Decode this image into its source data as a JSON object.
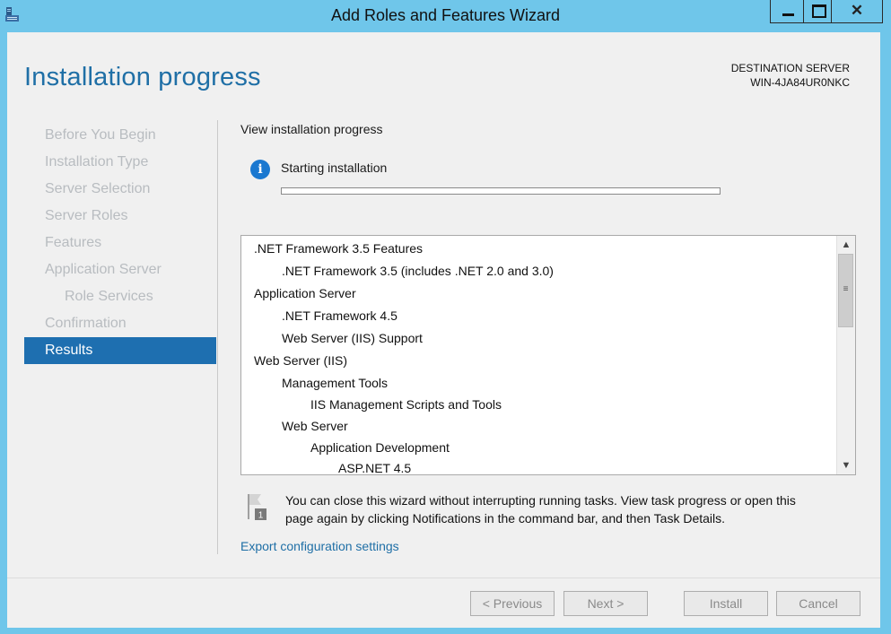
{
  "window": {
    "title": "Add Roles and Features Wizard",
    "controls": {
      "minimize": "minimize-icon",
      "maximize": "maximize-icon",
      "close": "✕"
    }
  },
  "header": {
    "title": "Installation progress",
    "destination_label": "DESTINATION SERVER",
    "destination_server": "WIN-4JA84UR0NKC"
  },
  "nav": {
    "items": [
      {
        "label": "Before You Begin"
      },
      {
        "label": "Installation Type"
      },
      {
        "label": "Server Selection"
      },
      {
        "label": "Server Roles"
      },
      {
        "label": "Features"
      },
      {
        "label": "Application Server"
      },
      {
        "label": "Role Services"
      },
      {
        "label": "Confirmation"
      },
      {
        "label": "Results"
      }
    ]
  },
  "main": {
    "section_label": "View installation progress",
    "status_icon": "info-icon",
    "status_text": "Starting installation",
    "progress_fraction": 0.0,
    "items": [
      ".NET Framework 3.5 Features",
      ".NET Framework 3.5 (includes .NET 2.0 and 3.0)",
      "Application Server",
      ".NET Framework 4.5",
      "Web Server (IIS) Support",
      "Web Server (IIS)",
      "Management Tools",
      "IIS Management Scripts and Tools",
      "Web Server",
      "Application Development",
      "ASP.NET 4.5"
    ],
    "note_icon": "notification-flag-icon",
    "note_badge": "1",
    "note_line1": "You can close this wizard without interrupting running tasks. View task progress or open this",
    "note_line2": "page again by clicking Notifications in the command bar, and then Task Details.",
    "export_link": "Export configuration settings"
  },
  "footer": {
    "previous": "< Previous",
    "next": "Next >",
    "install": "Install",
    "cancel": "Cancel"
  },
  "colors": {
    "titlebar": "#6fc6ea",
    "accent": "#1e6fb0",
    "title_text": "#1f6fa6"
  }
}
